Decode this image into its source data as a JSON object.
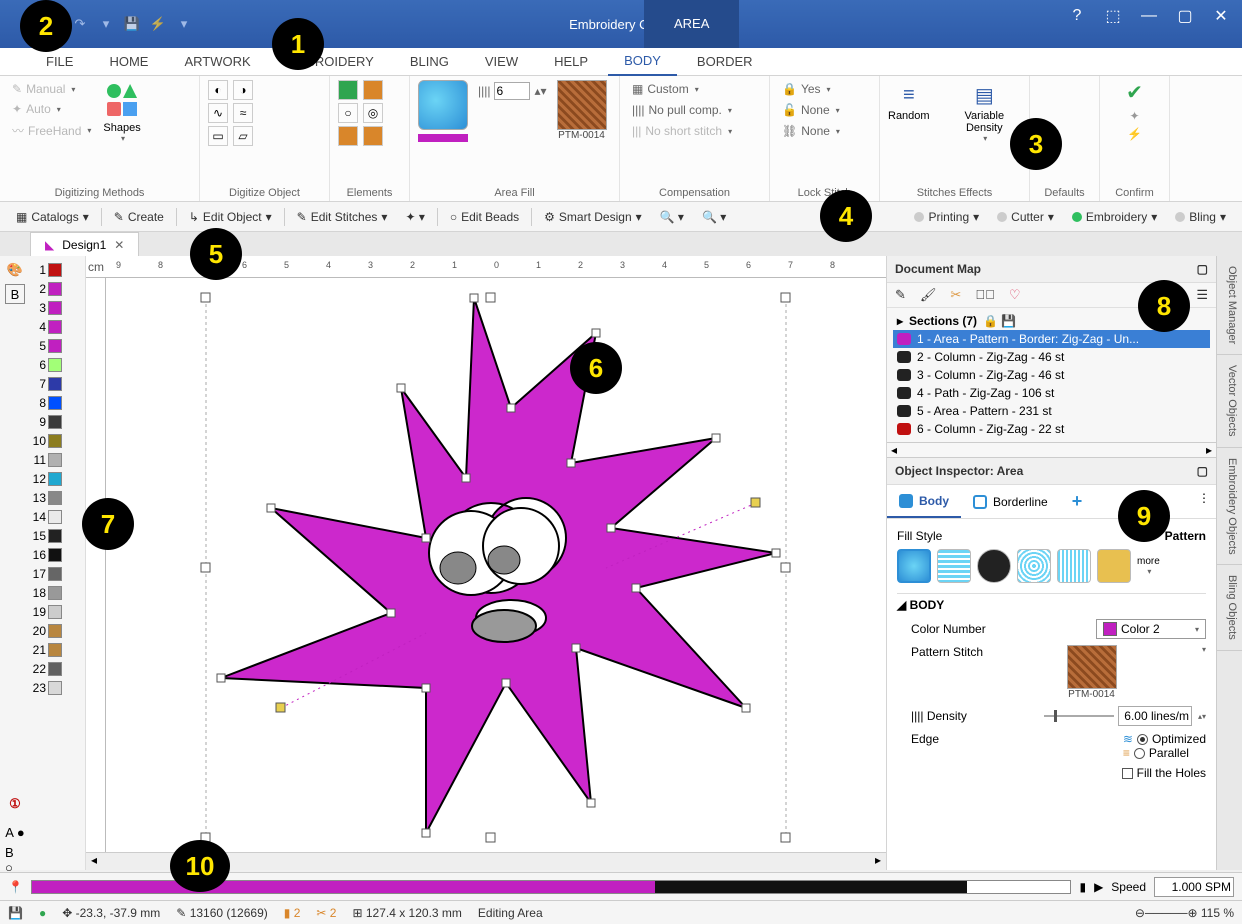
{
  "app_title": "Embroidery Office",
  "context_tab": "AREA",
  "menus": [
    "FILE",
    "HOME",
    "ARTWORK",
    "EMBROIDERY",
    "BLING",
    "VIEW",
    "HELP",
    "BODY",
    "BORDER"
  ],
  "active_menu_index": 7,
  "ribbon": {
    "dig": {
      "label": "Digitizing Methods",
      "manual": "Manual",
      "auto": "Auto",
      "freehand": "FreeHand",
      "shapes": "Shapes"
    },
    "dobj": {
      "label": "Digitize Object"
    },
    "elem": {
      "label": "Elements"
    },
    "areafill": {
      "label": "Area Fill",
      "pitch": "6",
      "ptm": "PTM-0014"
    },
    "comp": {
      "label": "Compensation",
      "custom": "Custom",
      "nopull": "No pull comp.",
      "noshort": "No short stitch"
    },
    "lock": {
      "label": "Lock Stitch",
      "yes": "Yes",
      "none1": "None",
      "none2": "None"
    },
    "se": {
      "label": "Stitches Effects",
      "random": "Random",
      "vardens": "Variable Density"
    },
    "defaults": {
      "label": "Defaults"
    },
    "confirm": {
      "label": "Confirm"
    }
  },
  "toolbar2": {
    "catalogs": "Catalogs",
    "create": "Create",
    "edit_object": "Edit Object",
    "edit_stitches": "Edit Stitches",
    "edit_beads": "Edit Beads",
    "smart": "Smart Design",
    "printing": "Printing",
    "cutter": "Cutter",
    "embroidery": "Embroidery",
    "bling": "Bling"
  },
  "doc_tab": "Design1",
  "ruler_unit": "cm",
  "ruler_ticks": [
    "9",
    "8",
    "7",
    "6",
    "5",
    "4",
    "3",
    "2",
    "1",
    "0",
    "1",
    "2",
    "3",
    "4",
    "5",
    "6",
    "7",
    "8"
  ],
  "palette_colors": [
    "#c01010",
    "#c020c0",
    "#c020c0",
    "#c020c0",
    "#c020c0",
    "#a2ff77",
    "#2d3aa8",
    "#0050ff",
    "#3a3a3a",
    "#8c7d1f",
    "#b0b0b0",
    "#20a8d0",
    "#888888",
    "#eaeaea",
    "#222222",
    "#111111",
    "#666666",
    "#999999",
    "#cccccc",
    "#b8863f",
    "#b8863f",
    "#606060",
    "#d8d8d8"
  ],
  "palette_mode": "2",
  "dm": {
    "title": "Document Map",
    "sections": "Sections (7)",
    "items": [
      {
        "txt": "1 - Area - Pattern - Border: Zig-Zag - Un...",
        "col": "#c020c0",
        "sel": true
      },
      {
        "txt": "2 - Column - Zig-Zag - 46 st",
        "col": "#222"
      },
      {
        "txt": "3 - Column - Zig-Zag - 46 st",
        "col": "#222"
      },
      {
        "txt": "4 - Path - Zig-Zag - 106 st",
        "col": "#222"
      },
      {
        "txt": "5 - Area - Pattern - 231 st",
        "col": "#222"
      },
      {
        "txt": "6 - Column - Zig-Zag - 22 st",
        "col": "#c01010"
      }
    ]
  },
  "oi": {
    "title": "Object Inspector: Area",
    "tabs": {
      "body": "Body",
      "border": "Borderline"
    },
    "fill_style": "Fill Style",
    "pattern": "Pattern",
    "more": "more",
    "body_hd": "BODY",
    "color_num": "Color Number",
    "color_val": "Color 2",
    "pattern_stitch": "Pattern Stitch",
    "ptm": "PTM-0014",
    "density": "Density",
    "density_val": "6.00 lines/m",
    "edge": "Edge",
    "opt": "Optimized",
    "par": "Parallel",
    "fill_holes": "Fill the Holes"
  },
  "side_tabs": [
    "Object Manager",
    "Vector Objects",
    "Embroidery Objects",
    "Bling Objects"
  ],
  "player": {
    "speed_label": "Speed",
    "speed_val": "1.000 SPM"
  },
  "status": {
    "coord": "-23.3, -37.9 mm",
    "stitches": "13160 (12669)",
    "colors": "2",
    "trims": "2",
    "size": "127.4 x 120.3 mm",
    "mode": "Editing Area",
    "zoom": "115 %"
  },
  "annots": [
    "1",
    "2",
    "3",
    "4",
    "5",
    "6",
    "7",
    "8",
    "9",
    "10"
  ]
}
